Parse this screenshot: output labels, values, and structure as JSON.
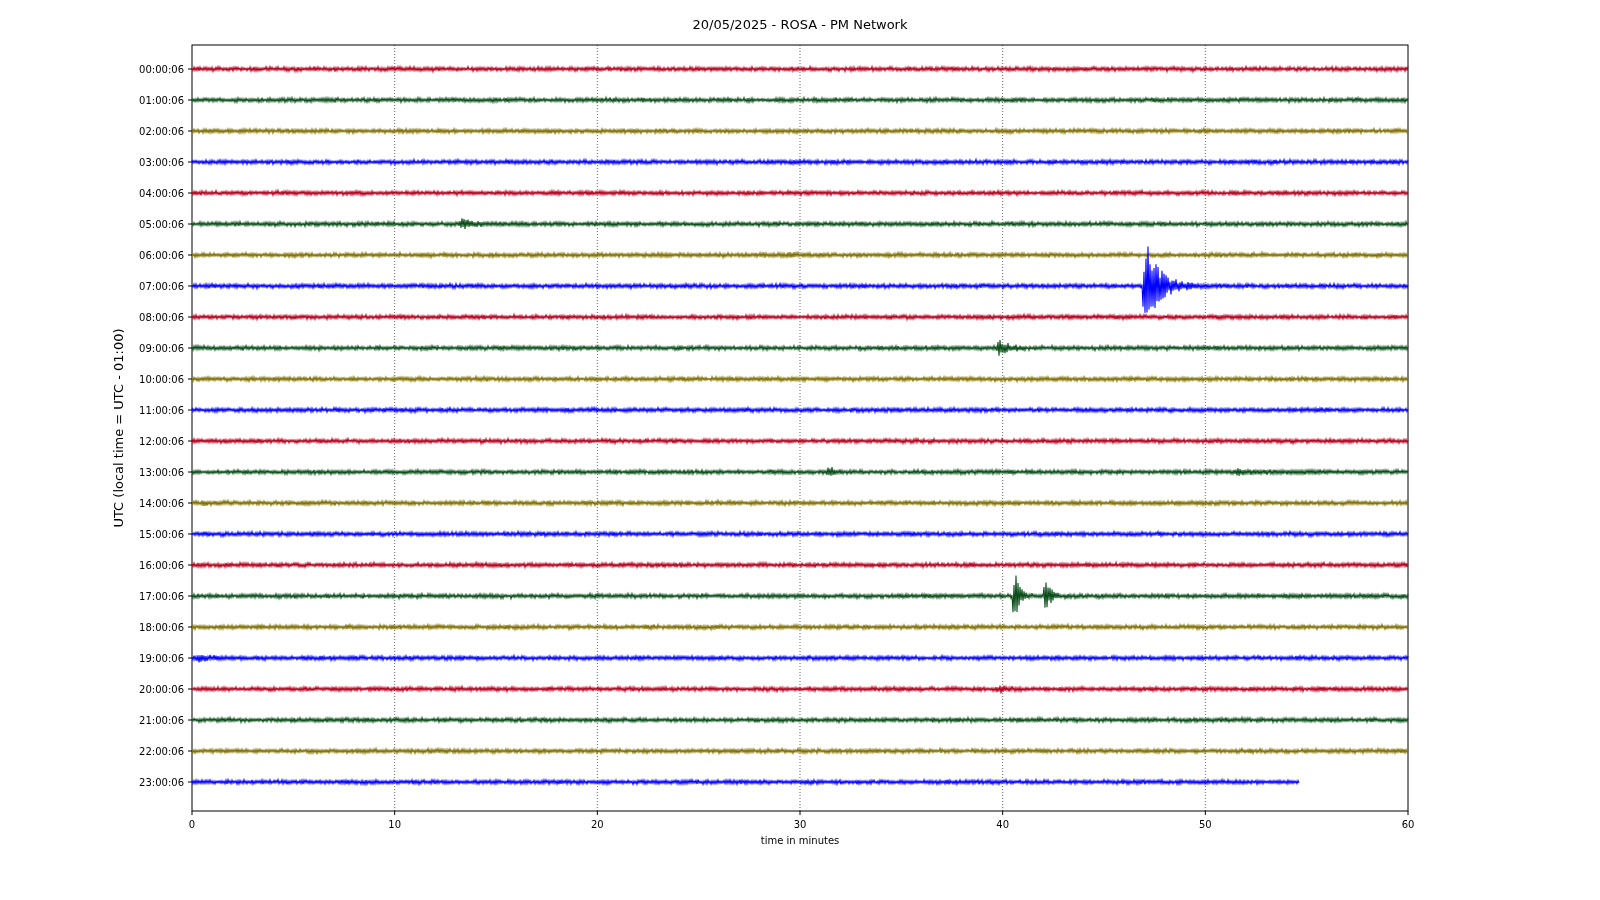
{
  "title": "20/05/2025 - ROSA - PM Network",
  "ylabel": "UTC (local time = UTC - 01:00)",
  "xlabel": "time in minutes",
  "xticks": [
    "0",
    "10",
    "20",
    "30",
    "40",
    "50",
    "60"
  ],
  "rows": [
    {
      "time": "00:00:06",
      "color": "#b5001e",
      "level": 1
    },
    {
      "time": "01:00:06",
      "color": "#0a4f1a",
      "level": 1
    },
    {
      "time": "02:00:06",
      "color": "#807000",
      "level": 1
    },
    {
      "time": "03:00:06",
      "color": "#0000ff",
      "level": 1
    },
    {
      "time": "04:00:06",
      "color": "#b5001e",
      "level": 1
    },
    {
      "time": "05:00:06",
      "color": "#0a4f1a",
      "level": 1
    },
    {
      "time": "06:00:06",
      "color": "#807000",
      "level": 1
    },
    {
      "time": "07:00:06",
      "color": "#0000ff",
      "level": 1
    },
    {
      "time": "08:00:06",
      "color": "#b5001e",
      "level": 1
    },
    {
      "time": "09:00:06",
      "color": "#0a4f1a",
      "level": 1
    },
    {
      "time": "10:00:06",
      "color": "#807000",
      "level": 1
    },
    {
      "time": "11:00:06",
      "color": "#0000ff",
      "level": 1
    },
    {
      "time": "12:00:06",
      "color": "#b5001e",
      "level": 1
    },
    {
      "time": "13:00:06",
      "color": "#0a4f1a",
      "level": 1
    },
    {
      "time": "14:00:06",
      "color": "#807000",
      "level": 1
    },
    {
      "time": "15:00:06",
      "color": "#0000ff",
      "level": 1
    },
    {
      "time": "16:00:06",
      "color": "#b5001e",
      "level": 1
    },
    {
      "time": "17:00:06",
      "color": "#0a4f1a",
      "level": 1
    },
    {
      "time": "18:00:06",
      "color": "#807000",
      "level": 1
    },
    {
      "time": "19:00:06",
      "color": "#0000ff",
      "level": 1
    },
    {
      "time": "20:00:06",
      "color": "#b5001e",
      "level": 1
    },
    {
      "time": "21:00:06",
      "color": "#0a4f1a",
      "level": 1
    },
    {
      "time": "22:00:06",
      "color": "#807000",
      "level": 1
    },
    {
      "time": "23:00:06",
      "color": "#0000ff",
      "level": 0.91
    }
  ]
}
